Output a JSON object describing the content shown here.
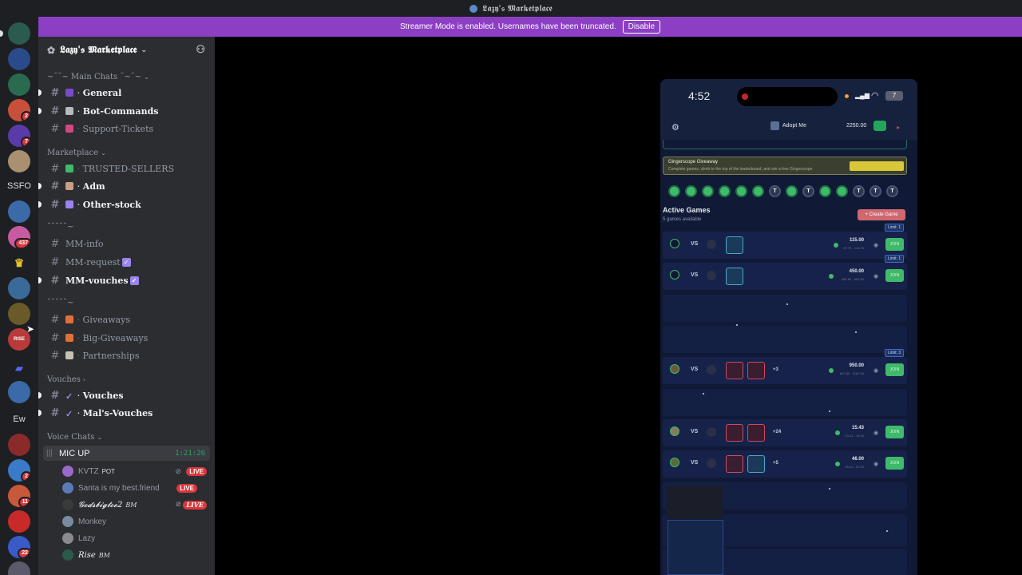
{
  "window": {
    "title": "𝕷𝖆𝖟𝖞'𝖘 𝕸𝖆𝖗𝖐𝖊𝖙𝖕𝖑𝖆𝖈𝖊"
  },
  "banner": {
    "text": "Streamer Mode is enabled. Usernames have been truncated.",
    "disable_label": "Disable"
  },
  "rail": {
    "servers": [
      {
        "name": "server-icon",
        "color": "#4a7a6a"
      },
      {
        "name": "server-icon",
        "color": "#3a5a9a",
        "badge": ""
      },
      {
        "name": "server-icon",
        "color": "#3a7a5a"
      },
      {
        "name": "server-icon",
        "color": "#c83a3a",
        "badge": "2"
      },
      {
        "name": "server-icon",
        "color": "#5a3aa8",
        "badge": "7"
      },
      {
        "name": "server-icon",
        "color": "#a89070"
      },
      {
        "name": "server-icon",
        "color": "#3a6aa8"
      },
      {
        "name": "server-icon",
        "color": "#c85aa0",
        "badge": "437"
      },
      {
        "name": "server-icon",
        "color": "#2a2a2a"
      },
      {
        "name": "server-icon",
        "color": "#3a6a9a"
      },
      {
        "name": "server-icon",
        "color": "#8a7a3a"
      },
      {
        "name": "server-icon",
        "color": "#b83a3a"
      },
      {
        "name": "server-icon",
        "color": "#3a5aa8"
      },
      {
        "name": "server-icon",
        "color": "#5a6aa8"
      },
      {
        "name": "server-icon",
        "color": "#c83a3a"
      },
      {
        "name": "server-icon",
        "color": "#3a7ac8",
        "badge": "2"
      },
      {
        "name": "server-icon",
        "color": "#c8583a",
        "badge": "11"
      },
      {
        "name": "server-icon",
        "color": "#c82a2a"
      },
      {
        "name": "server-icon",
        "color": "#3a5ac8",
        "badge": "22"
      }
    ],
    "text_ssfo": "SSFO",
    "text_ew": "Ew"
  },
  "sidebar": {
    "server_name": "𝕷𝖆𝖟𝖞'𝖘 𝕸𝖆𝖗𝖐𝖊𝖙𝖕𝖑𝖆𝖈𝖊",
    "categories": {
      "main": "~˘˘~ Main Chats ˘~˘~",
      "marketplace": "Marketplace",
      "mm": "˘˘˘˘˘~",
      "giveaways": "˘˘˘˘˘~",
      "vouches": "Vouches",
      "voice": "Voice Chats"
    },
    "channels": {
      "general": "General",
      "bot_commands": "Bot-Commands",
      "support_tickets": "Support-Tickets",
      "trusted_sellers": "TRUSTED-SELLERS",
      "adm": "Adm",
      "other_stock": "Other-stock",
      "mm_info": "MM-info",
      "mm_request": "MM-request",
      "mm_vouches": "MM-vouches",
      "giveaways": "Giveaways",
      "big_giveaways": "Big-Giveaways",
      "partnerships": "Partnerships",
      "vouches": "Vouches",
      "mals_vouches": "Mal's-Vouches"
    },
    "voice": {
      "channel": "MIC UP",
      "timer": "1:21:26",
      "users": [
        {
          "name": "KVTZ",
          "tag": "POT",
          "live": "LIVE"
        },
        {
          "name": "Santa is my best.friend",
          "tag": "",
          "live": "LIVE"
        },
        {
          "name": "𝓖𝓸𝓭𝓼𝓫𝓲𝓰𝓽𝓸𝓮2",
          "tag": "BM",
          "live": "LIVE"
        },
        {
          "name": "Monkey",
          "tag": "",
          "live": ""
        },
        {
          "name": "Lazy",
          "tag": "",
          "live": ""
        },
        {
          "name": "Rise",
          "tag": "BM",
          "live": ""
        }
      ]
    }
  },
  "phone": {
    "time": "4:52",
    "battery": "7",
    "nav": {
      "adopt_label": "Adopt Me",
      "balance": "2250.00"
    },
    "giveaway": {
      "title": "Gingerscope Giveaway",
      "subtitle": "Complete games, climb to the top of the leaderboard, and win a free Gingerscope"
    },
    "tokens": [
      "",
      "",
      "",
      "",
      "",
      "",
      "T",
      "",
      "T",
      "",
      "",
      "T",
      "T",
      "T"
    ],
    "active_title": "Active Games",
    "active_sub": "5 games available",
    "create_label": "+ Create Game",
    "games": [
      {
        "amount": "115.00",
        "range": "97.75 - 143.75",
        "limit": "Limit: 1",
        "more": "",
        "join": "JOIN"
      },
      {
        "amount": "450.00",
        "range": "382.50 - 562.50",
        "limit": "Limit: 1",
        "more": "",
        "join": "JOIN"
      },
      {
        "amount": "950.00",
        "range": "807.50 - 1187.50",
        "limit": "Limit: 3",
        "more": "+3",
        "join": "JOIN"
      },
      {
        "amount": "15.43",
        "range": "13.12 - 19.29",
        "limit": "",
        "more": "+24",
        "join": "JOIN"
      },
      {
        "amount": "46.00",
        "range": "39.10 - 57.50",
        "limit": "",
        "more": "+5",
        "join": "JOIN"
      }
    ]
  }
}
